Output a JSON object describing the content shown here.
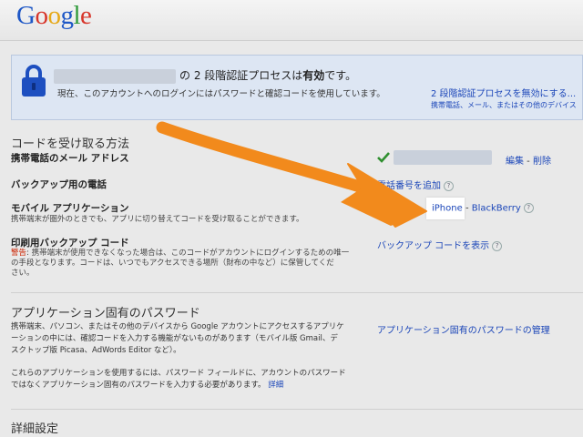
{
  "brand": {
    "letters": [
      "G",
      "o",
      "o",
      "g",
      "l",
      "e"
    ]
  },
  "banner": {
    "title_suffix": "の 2 段階認証プロセスは",
    "title_bold": "有効",
    "title_end": "です。",
    "desc": "現在、このアカウントへのログインにはパスワードと確認コードを使用しています。",
    "disable_link": "2 段階認証プロセスを無効にする...",
    "sub_note": "携帯電話、メール、またはその他のデバイス"
  },
  "receive": {
    "section_title": "コードを受け取る方法",
    "phone_label": "携帯電話のメール アドレス",
    "edit_link": "編集",
    "separator": " - ",
    "delete_link": "削除",
    "backup_phone_label": "バックアップ用の電話",
    "add_phone_link": "電話番号を追加",
    "mobile_app_label": "モバイル アプリケーション",
    "mobile_app_desc": "携帯端末が圏外のときでも、アプリに切り替えてコードを受け取ることができます。",
    "iphone_link": "iPhone",
    "blackberry_link": "BlackBerry",
    "backup_codes_label": "印刷用バックアップ コード",
    "backup_warn": "警告",
    "backup_desc_1": ": 携帯端末が使用できなくなった場合は、このコードがアカウントにログインするための唯一",
    "backup_desc_2": "の手段となります。コードは、いつでもアクセスできる場所（財布の中など）に保管してくだ",
    "backup_desc_3": "さい。",
    "show_codes_link": "バックアップ コードを表示"
  },
  "app_passwords": {
    "section_title": "アプリケーション固有のパスワード",
    "desc_1": "携帯端末、パソコン、またはその他のデバイスから Google アカウントにアクセスするアプリケ",
    "desc_2": "ーションの中には、確認コードを入力する機能がないものがあります（モバイル版 Gmail、デ",
    "desc_3": "スクトップ版 Picasa、AdWords Editor など）。",
    "desc_4": "これらのアプリケーションを使用するには、パスワード フィールドに、アカウントのパスワード",
    "desc_5": "ではなくアプリケーション固有のパスワードを入力する必要があります。",
    "details_link": "詳細",
    "manage_link": "アプリケーション固有のパスワードの管理"
  },
  "advanced": {
    "section_title": "詳細設定"
  },
  "help_glyph": "?",
  "colors": {
    "link": "#1a45b8",
    "arrow": "#f28a1c",
    "check": "#2f8f2f",
    "warn": "#cc2200"
  }
}
